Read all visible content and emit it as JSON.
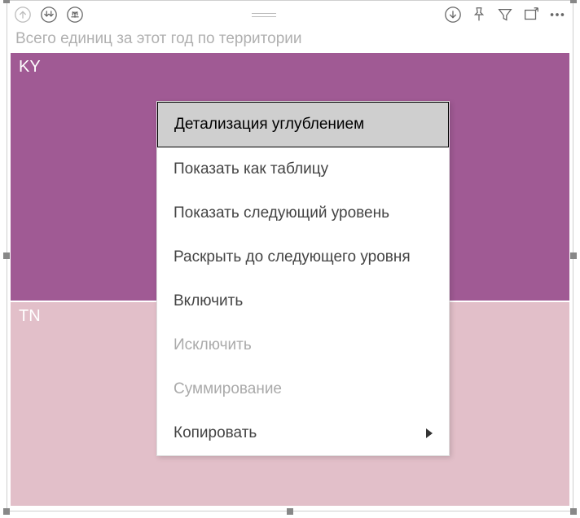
{
  "title": "Всего единиц за этот год по территории",
  "tiles": {
    "ky": {
      "label": "KY",
      "color": "#a05a94"
    },
    "tn": {
      "label": "TN",
      "color": "#e2bfc9"
    }
  },
  "menu": {
    "drill_down": "Детализация углублением",
    "show_as_table": "Показать как таблицу",
    "show_next_level": "Показать следующий уровень",
    "expand_next_level": "Раскрыть до следующего уровня",
    "include": "Включить",
    "exclude": "Исключить",
    "summarize": "Суммирование",
    "copy": "Копировать"
  },
  "toolbar_icons": {
    "drill_up": "drill-up-icon",
    "drill_all": "drill-all-down-icon",
    "drill_one": "drill-one-icon",
    "drill_mode": "drill-mode-icon",
    "pin": "pin-icon",
    "filter": "filter-icon",
    "focus": "focus-mode-icon",
    "more": "more-options-icon"
  },
  "chart_data": {
    "type": "treemap",
    "title": "Всего единиц за этот год по территории",
    "series": [
      {
        "name": "KY",
        "value_proportion": 0.55,
        "color": "#a05a94"
      },
      {
        "name": "TN",
        "value_proportion": 0.45,
        "color": "#e2bfc9"
      }
    ]
  }
}
